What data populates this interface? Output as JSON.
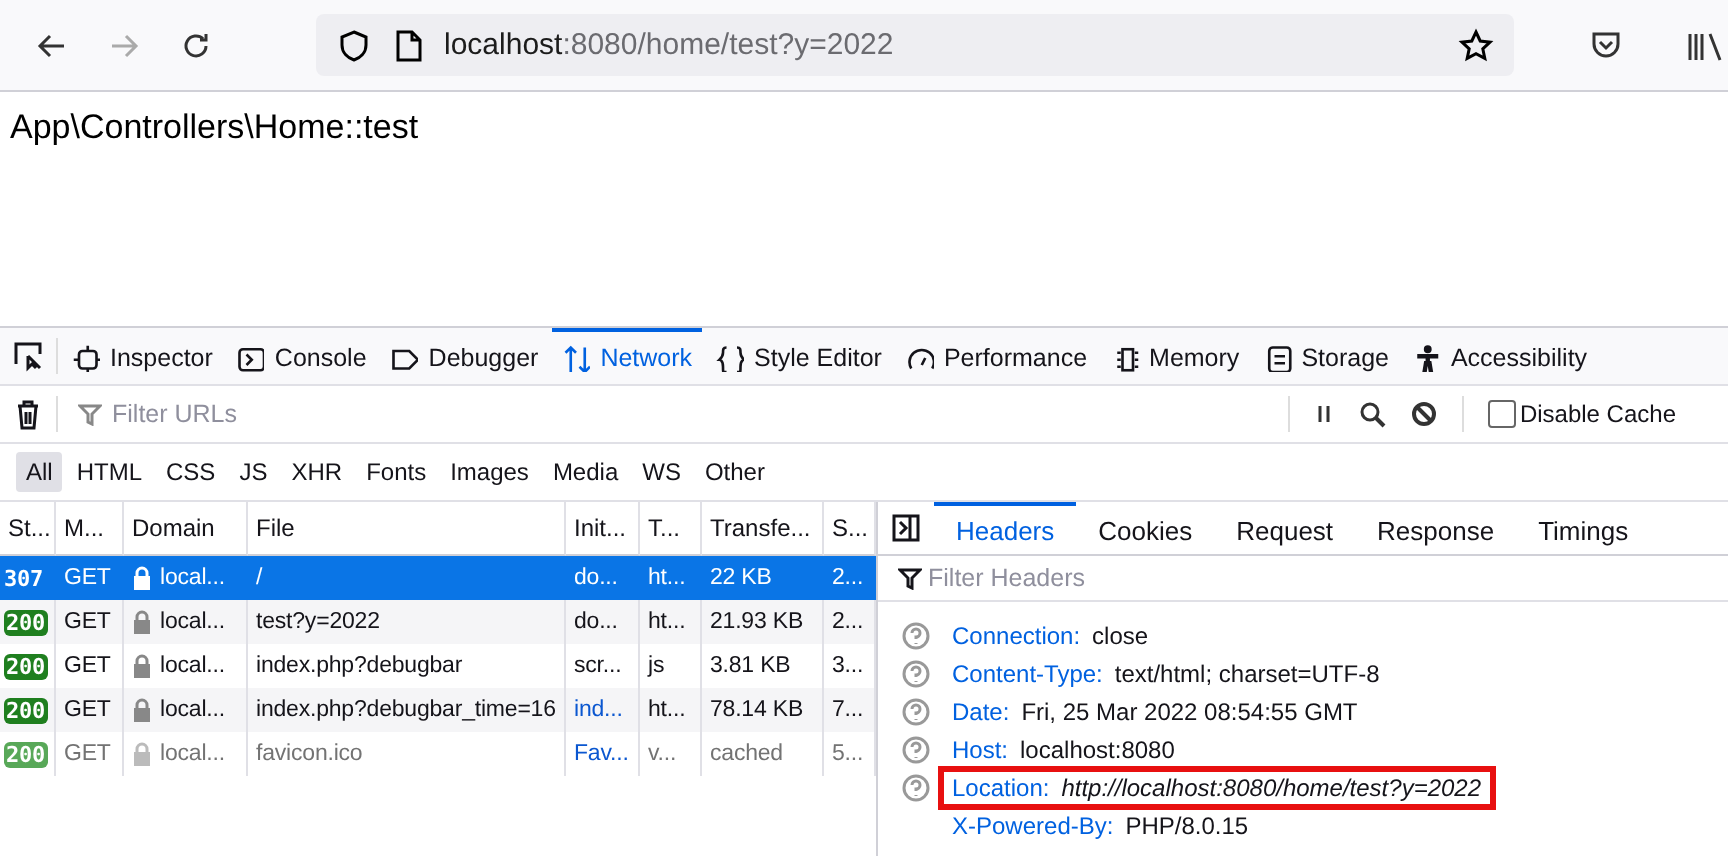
{
  "browser": {
    "nav": [
      {
        "kind": "back",
        "disabled": false
      },
      {
        "kind": "forward",
        "disabled": true
      },
      {
        "kind": "reload",
        "disabled": false
      }
    ],
    "url_host": "localhost",
    "url_rest": ":8080/home/test?y=2022"
  },
  "page_text": "App\\Controllers\\Home::test",
  "devtools_tabs": [
    {
      "label": "Inspector",
      "selected": false
    },
    {
      "label": "Console",
      "selected": false
    },
    {
      "label": "Debugger",
      "selected": false
    },
    {
      "label": "Network",
      "selected": true
    },
    {
      "label": "Style Editor",
      "selected": false
    },
    {
      "label": "Performance",
      "selected": false
    },
    {
      "label": "Memory",
      "selected": false
    },
    {
      "label": "Storage",
      "selected": false
    },
    {
      "label": "Accessibility",
      "selected": false
    }
  ],
  "network": {
    "filter": {
      "placeholder": "Filter URLs"
    },
    "disable_cache": {
      "label": "Disable Cache",
      "checked": false
    },
    "type_filters": [
      {
        "label": "All",
        "selected": true
      },
      {
        "label": "HTML",
        "selected": false
      },
      {
        "label": "CSS",
        "selected": false
      },
      {
        "label": "JS",
        "selected": false
      },
      {
        "label": "XHR",
        "selected": false
      },
      {
        "label": "Fonts",
        "selected": false
      },
      {
        "label": "Images",
        "selected": false
      },
      {
        "label": "Media",
        "selected": false
      },
      {
        "label": "WS",
        "selected": false
      },
      {
        "label": "Other",
        "selected": false
      }
    ],
    "columns": [
      "St...",
      "M...",
      "Domain",
      "File",
      "Init...",
      "T...",
      "Transfe...",
      "S..."
    ],
    "rows": [
      {
        "status": "307",
        "method": "GET",
        "domain": "local...",
        "file": "/",
        "initiator": "do...",
        "initiator_link": false,
        "type": "ht...",
        "transferred": "22 KB",
        "size": "2...",
        "selected": true,
        "faded": false
      },
      {
        "status": "200",
        "method": "GET",
        "domain": "local...",
        "file": "test?y=2022",
        "initiator": "do...",
        "initiator_link": false,
        "type": "ht...",
        "transferred": "21.93 KB",
        "size": "2...",
        "selected": false,
        "faded": false
      },
      {
        "status": "200",
        "method": "GET",
        "domain": "local...",
        "file": "index.php?debugbar",
        "initiator": "scr...",
        "initiator_link": false,
        "type": "js",
        "transferred": "3.81 KB",
        "size": "3...",
        "selected": false,
        "faded": false
      },
      {
        "status": "200",
        "method": "GET",
        "domain": "local...",
        "file": "index.php?debugbar_time=16",
        "initiator": "ind...",
        "initiator_link": true,
        "type": "ht...",
        "transferred": "78.14 KB",
        "size": "7...",
        "selected": false,
        "faded": false
      },
      {
        "status": "200",
        "method": "GET",
        "domain": "local...",
        "file": "favicon.ico",
        "initiator": "Fav...",
        "initiator_link": true,
        "type": "v...",
        "transferred": "cached",
        "size": "5...",
        "selected": false,
        "faded": true
      }
    ]
  },
  "details": {
    "tabs": [
      {
        "label": "Headers",
        "selected": true
      },
      {
        "label": "Cookies",
        "selected": false
      },
      {
        "label": "Request",
        "selected": false
      },
      {
        "label": "Response",
        "selected": false
      },
      {
        "label": "Timings",
        "selected": false
      }
    ],
    "filter": {
      "placeholder": "Filter Headers"
    },
    "headers": [
      {
        "name": "Connection:",
        "value": "close",
        "help": true,
        "highlighted": false
      },
      {
        "name": "Content-Type:",
        "value": "text/html; charset=UTF-8",
        "help": true,
        "highlighted": false
      },
      {
        "name": "Date:",
        "value": "Fri, 25 Mar 2022 08:54:55 GMT",
        "help": true,
        "highlighted": false
      },
      {
        "name": "Host:",
        "value": "localhost:8080",
        "help": true,
        "highlighted": false
      },
      {
        "name": "Location:",
        "value": "http://localhost:8080/home/test?y=2022",
        "help": true,
        "highlighted": true
      },
      {
        "name": "X-Powered-By:",
        "value": "PHP/8.0.15",
        "help": false,
        "highlighted": false
      }
    ]
  }
}
